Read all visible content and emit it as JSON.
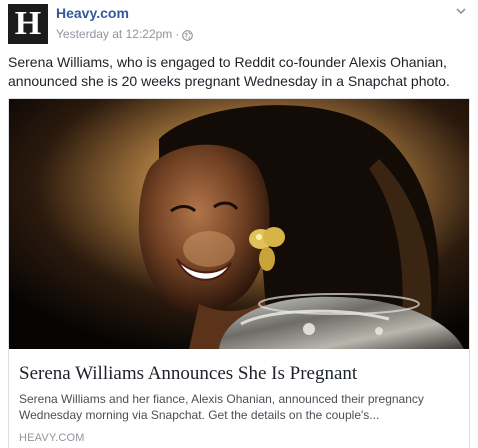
{
  "header": {
    "avatar_letter": "H",
    "page_name": "Heavy.com",
    "timestamp": "Yesterday at 12:22pm",
    "separator": "·",
    "privacy_icon": "globe-icon",
    "options_icon": "chevron-down-icon"
  },
  "post": {
    "text": "Serena Williams, who is engaged to Reddit co-founder Alexis Ohanian, announced she is 20 weeks pregnant Wednesday in a Snapchat photo."
  },
  "link_preview": {
    "title": "Serena Williams Announces She Is Pregnant",
    "description": "Serena Williams and her fiance, Alexis Ohanian, announced their pregnancy Wednesday morning via Snapchat. Get the details on the couple's...",
    "domain": "HEAVY.COM"
  },
  "colors": {
    "page_link": "#365899",
    "meta_text": "#90949c",
    "body_text": "#1d2129"
  }
}
